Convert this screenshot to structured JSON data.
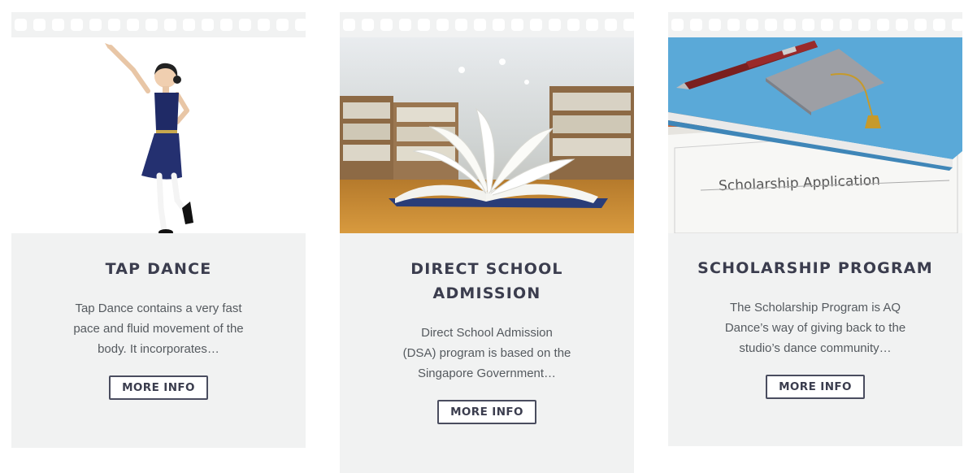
{
  "cards": [
    {
      "title_lines": [
        "TAP DANCE"
      ],
      "desc_lines": [
        "Tap Dance contains a very fast",
        "pace and fluid movement of the",
        "body. It incorporates…"
      ],
      "button": "MORE INFO",
      "image": "tap-dancer-photo"
    },
    {
      "title_lines": [
        "DIRECT SCHOOL",
        "ADMISSION"
      ],
      "desc_lines": [
        "Direct School Admission",
        "(DSA) program is based on the",
        "Singapore Government…"
      ],
      "button": "MORE INFO",
      "image": "open-book-library-photo"
    },
    {
      "title_lines": [
        "SCHOLARSHIP PROGRAM"
      ],
      "desc_lines": [
        "The Scholarship Program is AQ",
        "Dance’s way of giving back to the",
        "studio’s dance community…"
      ],
      "button": "MORE INFO",
      "image": "scholarship-application-photo",
      "image_text": "Scholarship Application"
    }
  ],
  "colors": {
    "card_bg": "#f1f2f2",
    "heading": "#3b3d4e",
    "body_text": "#555a5f",
    "button_border": "#4a4d5f"
  }
}
